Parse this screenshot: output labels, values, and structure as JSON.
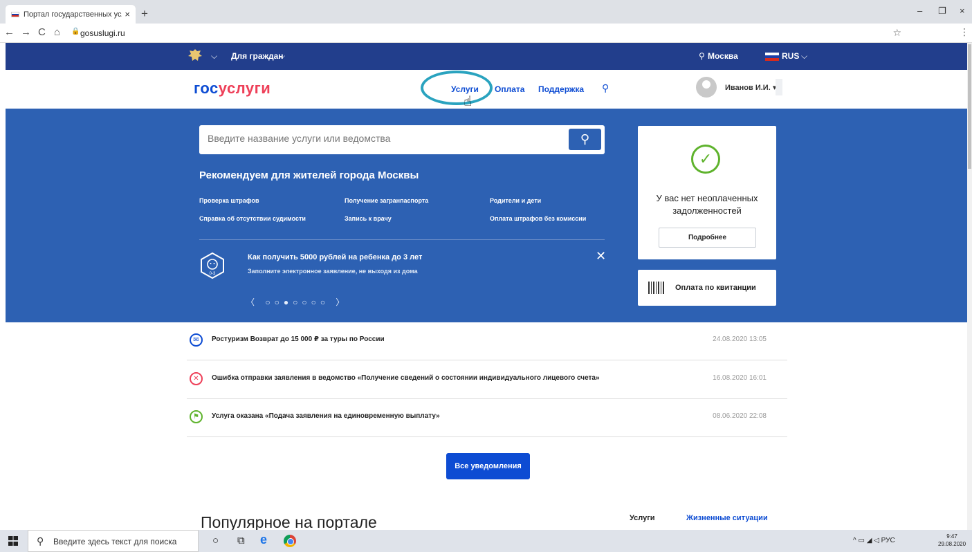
{
  "browser": {
    "tab_title": "Портал государственных услуг",
    "tab_close": "×",
    "new_tab": "+",
    "url": "gosuslugi.ru",
    "nav": {
      "back": "←",
      "forward": "→",
      "reload": "C",
      "home": "⌂"
    },
    "star": "☆",
    "menu": "⋮",
    "window": {
      "minimize": "–",
      "restore": "❐",
      "close": "×"
    }
  },
  "govbar": {
    "citizens_label": "Для граждан",
    "chevron": "⌵",
    "location_pin": "⚲",
    "location": "Москва",
    "language": "RUS"
  },
  "header": {
    "logo_part1": "гос",
    "logo_part2": "услуги",
    "nav": [
      "Услуги",
      "Оплата",
      "Поддержка"
    ],
    "search_glyph": "⚲",
    "user_name": "Иванов И.И.",
    "user_caret": "▾",
    "cursor_glyph": "☝"
  },
  "hero": {
    "search_placeholder": "Введите название услуги или ведомства",
    "search_glyph": "⚲",
    "recommend_title": "Рекомендуем для жителей города Москвы",
    "links": [
      "Проверка штрафов",
      "Получение загранпаспорта",
      "Родители и дети",
      "Справка об отсутствии судимости",
      "Запись к врачу",
      "Оплата штрафов без комиссии"
    ],
    "promo_title": "Как получить 5000 рублей на ребенка до 3 лет",
    "promo_subtitle": "Заполните электронное заявление, не выходя из дома",
    "promo_close": "✕",
    "pager": "〈 ○○●○○○○ 〉",
    "baby_label": "0-3"
  },
  "debt_card": {
    "check_glyph": "✓",
    "message": "У вас нет неоплаченных задолженностей",
    "button": "Подробнее"
  },
  "receipt_card": {
    "label": "Оплата по квитанции"
  },
  "notifications": [
    {
      "icon": "message-icon",
      "glyph": "✉",
      "color": "#0d4cd3",
      "text": "Ростуризм Возврат до 15 000 ₽ за туры по России",
      "time": "24.08.2020 13:05"
    },
    {
      "icon": "error-icon",
      "glyph": "✕",
      "color": "#ee3f58",
      "text": "Ошибка отправки заявления в ведомство «Получение сведений о состоянии индивидуального лицевого счета»",
      "time": "16.08.2020 16:01"
    },
    {
      "icon": "success-icon",
      "glyph": "⚑",
      "color": "#5fb32d",
      "text": "Услуга оказана «Подача заявления на единовременную выплату»",
      "time": "08.06.2020 22:08"
    }
  ],
  "all_notifications_button": "Все уведомления",
  "popular": {
    "title": "Популярное на портале",
    "tabs": [
      "Услуги",
      "Жизненные ситуации"
    ]
  },
  "taskbar": {
    "search_glyph": "⚲",
    "search_placeholder": "Введите здесь текст для поиска",
    "cortana_glyph": "○",
    "taskview_glyph": "⧉",
    "edge_glyph": "e",
    "tray": "^ ▭ ◢ ◁ РУС",
    "time": "9:47",
    "date": "29.08.2020"
  },
  "colors": {
    "gov_blue": "#223e8c",
    "hero_blue": "#2d61b3",
    "link_blue": "#0d4cd3",
    "logo_red": "#ee3f58"
  }
}
